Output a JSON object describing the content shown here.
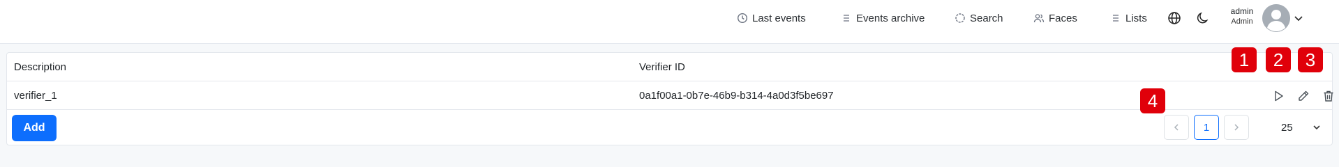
{
  "header": {
    "nav": [
      {
        "label": "Last events",
        "icon": "clock-icon"
      },
      {
        "label": "Events archive",
        "icon": "list-icon"
      },
      {
        "label": "Search",
        "icon": "search-circle-icon"
      },
      {
        "label": "Faces",
        "icon": "users-icon"
      },
      {
        "label": "Lists",
        "icon": "list-icon"
      }
    ],
    "user": {
      "name": "admin",
      "role": "Admin"
    }
  },
  "table": {
    "columns": [
      "Description",
      "Verifier ID"
    ],
    "rows": [
      {
        "description": "verifier_1",
        "verifier_id": "0a1f00a1-0b7e-46b9-b314-4a0d3f5be697"
      }
    ]
  },
  "footer": {
    "add_label": "Add",
    "current_page": "1",
    "per_page": "25"
  },
  "markers": [
    "1",
    "2",
    "3",
    "4"
  ],
  "colors": {
    "primary": "#0d6efd",
    "marker": "#e0000a"
  }
}
